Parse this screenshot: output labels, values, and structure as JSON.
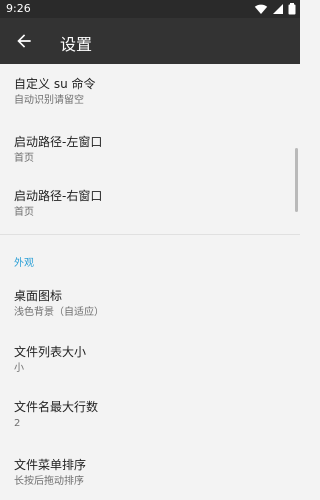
{
  "status_bar": {
    "time": "9:26"
  },
  "app_bar": {
    "title": "设置"
  },
  "items": [
    {
      "title": "自定义 su 命令",
      "subtitle": "自动识别请留空"
    },
    {
      "title": "启动路径-左窗口",
      "subtitle": "首页"
    },
    {
      "title": "启动路径-右窗口",
      "subtitle": "首页"
    }
  ],
  "section_appearance": {
    "label": "外观"
  },
  "appearance_items": [
    {
      "title": "桌面图标",
      "subtitle": "浅色背景（自适应）"
    },
    {
      "title": "文件列表大小",
      "subtitle": "小"
    },
    {
      "title": "文件名最大行数",
      "subtitle": "2"
    },
    {
      "title": "文件菜单排序",
      "subtitle": "长按后拖动排序"
    }
  ]
}
